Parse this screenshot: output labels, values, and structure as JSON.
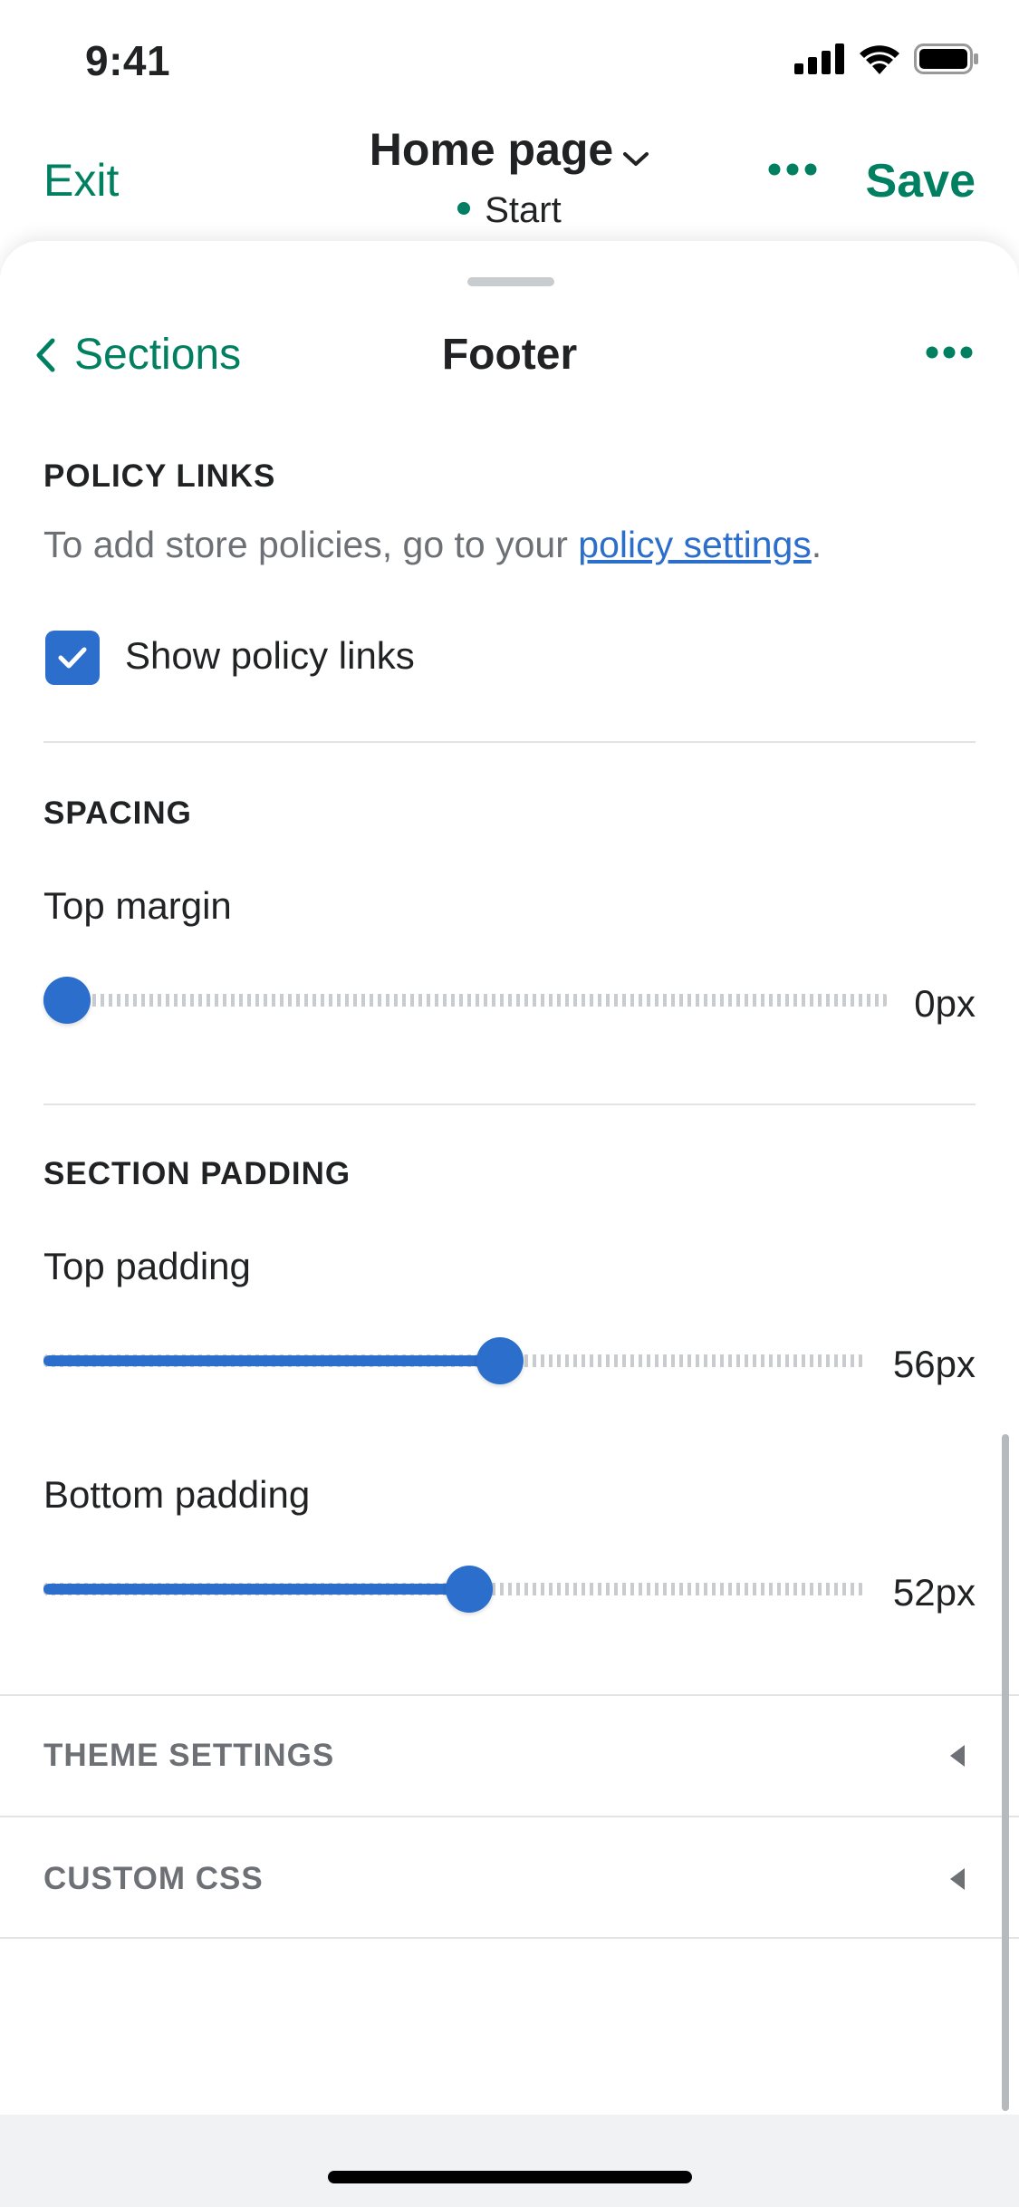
{
  "status_bar": {
    "time": "9:41",
    "icons": [
      "signal-icon",
      "wifi-icon",
      "battery-icon"
    ]
  },
  "header": {
    "exit_label": "Exit",
    "title": "Home page",
    "subtitle": "Start",
    "save_label": "Save"
  },
  "nav": {
    "back_label": "Sections",
    "title": "Footer"
  },
  "policy_links": {
    "heading": "POLICY LINKS",
    "help_prefix": "To add store policies, go to your ",
    "help_link": "policy settings",
    "help_suffix": ".",
    "checkbox_label": "Show policy links",
    "checkbox_checked": true
  },
  "spacing": {
    "heading": "SPACING",
    "top_margin": {
      "label": "Top margin",
      "value": "0px",
      "fraction": 0.0
    }
  },
  "section_padding": {
    "heading": "SECTION PADDING",
    "top_padding": {
      "label": "Top padding",
      "value": "56px",
      "fraction": 0.56
    },
    "bottom_padding": {
      "label": "Bottom padding",
      "value": "52px",
      "fraction": 0.52
    }
  },
  "collapsibles": [
    {
      "label": "THEME SETTINGS"
    },
    {
      "label": "CUSTOM CSS"
    }
  ],
  "colors": {
    "accent_green": "#008060",
    "interactive_blue": "#2c6ecb",
    "text": "#202223",
    "subdued_text": "#6d7175"
  }
}
